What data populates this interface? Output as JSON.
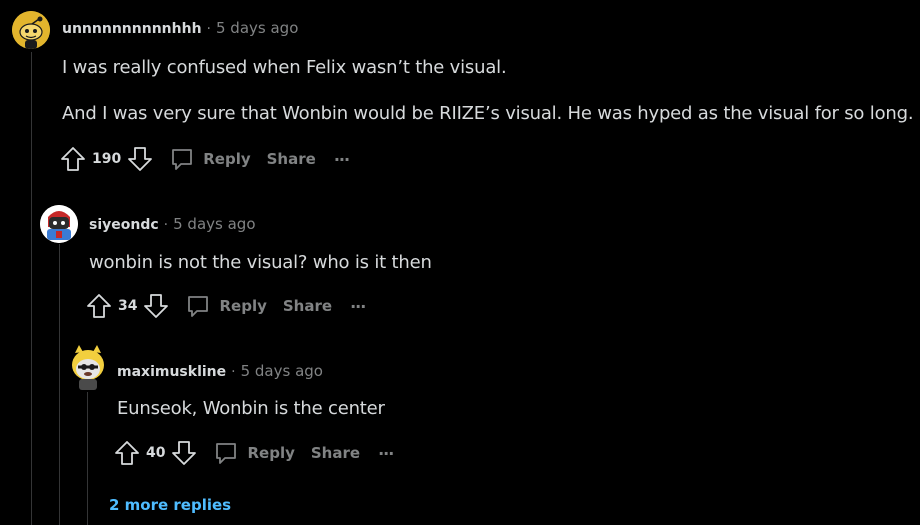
{
  "comments": [
    {
      "username": "unnnnnnnnnnhhh",
      "separator": "·",
      "time": "5 days ago",
      "paragraphs": [
        "I was really confused when Felix wasn’t the visual.",
        "And I was very sure that Wonbin would be RIIZE’s visual. He was hyped as the visual for so long."
      ],
      "votes": "190",
      "reply_label": "Reply",
      "share_label": "Share",
      "more_label": "···"
    },
    {
      "username": "siyeondc",
      "separator": "·",
      "time": "5 days ago",
      "paragraphs": [
        "wonbin is not the visual? who is it then"
      ],
      "votes": "34",
      "reply_label": "Reply",
      "share_label": "Share",
      "more_label": "···"
    },
    {
      "username": "maximuskline",
      "separator": "·",
      "time": "5 days ago",
      "paragraphs": [
        "Eunseok, Wonbin is the center"
      ],
      "votes": "40",
      "reply_label": "Reply",
      "share_label": "Share",
      "more_label": "···"
    }
  ],
  "more_replies_label": "2 more replies",
  "colors": {
    "background": "#000000",
    "text": "#d7dadc",
    "muted": "#818384",
    "link": "#4fbcff",
    "thread_line": "#343536"
  }
}
